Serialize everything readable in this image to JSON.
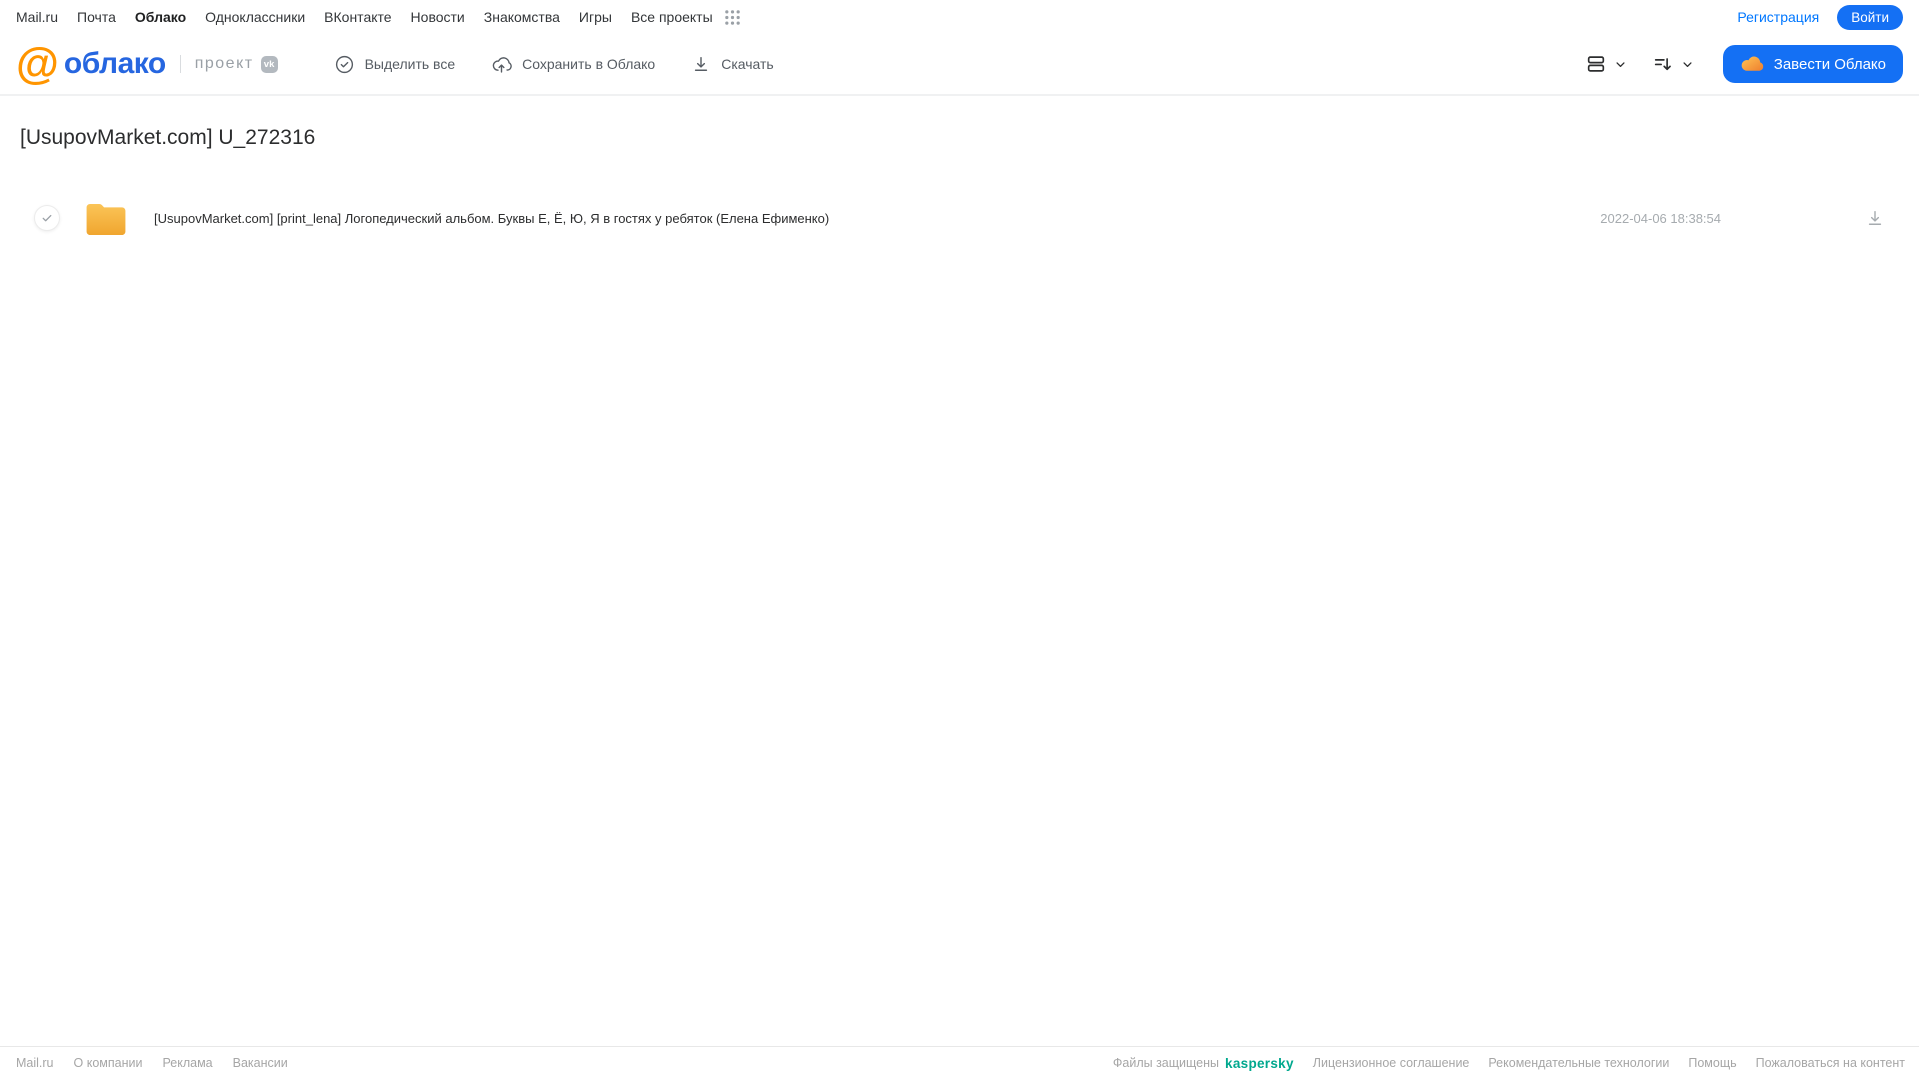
{
  "topbar": {
    "links": [
      "Mail.ru",
      "Почта",
      "Облако",
      "Одноклассники",
      "ВКонтакте",
      "Новости",
      "Знакомства",
      "Игры",
      "Все проекты"
    ],
    "registration": "Регистрация",
    "login": "Войти"
  },
  "header": {
    "logo_at": "@",
    "logo_text": "облако",
    "project_label": "проект",
    "vk_badge": "vk",
    "toolbar": {
      "select_all": "Выделить все",
      "save_to_cloud": "Сохранить в Облако",
      "download": "Скачать"
    },
    "get_cloud_button": "Завести Облако"
  },
  "page": {
    "title": "[UsupovMarket.com] U_272316"
  },
  "files": [
    {
      "type": "folder",
      "name": "[UsupovMarket.com] [print_lena] Логопедический альбом. Буквы Е, Ё, Ю, Я в гостях у ребяток (Елена Ефименко)",
      "date": "2022-04-06 18:38:54"
    }
  ],
  "footer": {
    "left_links": [
      "Mail.ru",
      "О компании",
      "Реклама",
      "Вакансии"
    ],
    "protected_label": "Файлы защищены",
    "kaspersky": "kaspersky",
    "right_links": [
      "Лицензионное соглашение",
      "Рекомендательные технологии",
      "Помощь",
      "Пожаловаться на контент"
    ]
  },
  "icons": [
    "apps-grid-icon",
    "check-circle-icon",
    "cloud-upload-icon",
    "download-icon",
    "list-view-icon",
    "sort-icon",
    "chevron-down-icon",
    "cloud-icon",
    "folder-icon",
    "vk-badge-icon",
    "check-icon"
  ],
  "colors": {
    "accent_blue": "#1470f4",
    "link_blue": "#0077ff",
    "logo_blue": "#2666e0",
    "logo_orange": "#ff9500",
    "folder_top": "#fbc558",
    "folder_bottom": "#f0a62f",
    "kaspersky_green": "#00a88e",
    "muted_gray": "#a6abaf"
  }
}
